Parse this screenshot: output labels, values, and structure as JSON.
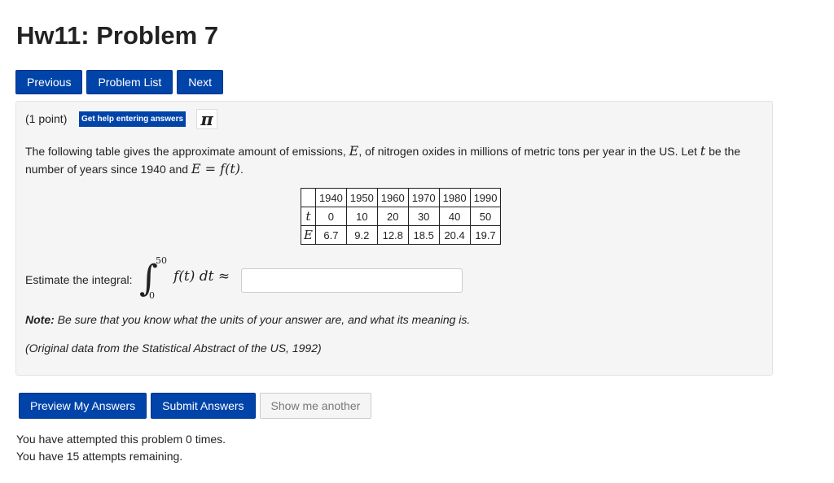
{
  "page": {
    "title": "Hw11: Problem 7"
  },
  "nav": {
    "previous": "Previous",
    "problem_list": "Problem List",
    "next": "Next"
  },
  "problem": {
    "points": "(1 point)",
    "help_button": "Get help entering answers",
    "pi_symbol": "π",
    "statement_part1": "The following table gives the approximate amount of emissions, ",
    "var_E": "E",
    "statement_part2": ", of nitrogen oxides in millions of metric tons per year in the US. Let ",
    "var_t": "t",
    "statement_part3": " be the number of years since 1940 and ",
    "equation": "E = f(t)",
    "statement_end": ".",
    "table": {
      "header": [
        "1940",
        "1950",
        "1960",
        "1970",
        "1980",
        "1990"
      ],
      "rows": [
        {
          "label": "t",
          "values": [
            "0",
            "10",
            "20",
            "30",
            "40",
            "50"
          ]
        },
        {
          "label": "E",
          "values": [
            "6.7",
            "9.2",
            "12.8",
            "18.5",
            "20.4",
            "19.7"
          ]
        }
      ]
    },
    "estimate_label": "Estimate the integral:",
    "integral_sign": "∫",
    "integral_upper": "50",
    "integral_lower": "0",
    "integrand": "f(t) dt ≈",
    "answer_value": "",
    "note_label": "Note:",
    "note_text": " Be sure that you know what the units of your answer are, and what its meaning is.",
    "source_text": "(Original data from the Statistical Abstract of the US, 1992)"
  },
  "actions": {
    "preview": "Preview My Answers",
    "submit": "Submit Answers",
    "show_another": "Show me another"
  },
  "attempts": {
    "line1": "You have attempted this problem 0 times.",
    "line2": "You have 15 attempts remaining."
  },
  "colors": {
    "primary_button": "#0044aa",
    "panel_background": "#f5f5f5"
  }
}
